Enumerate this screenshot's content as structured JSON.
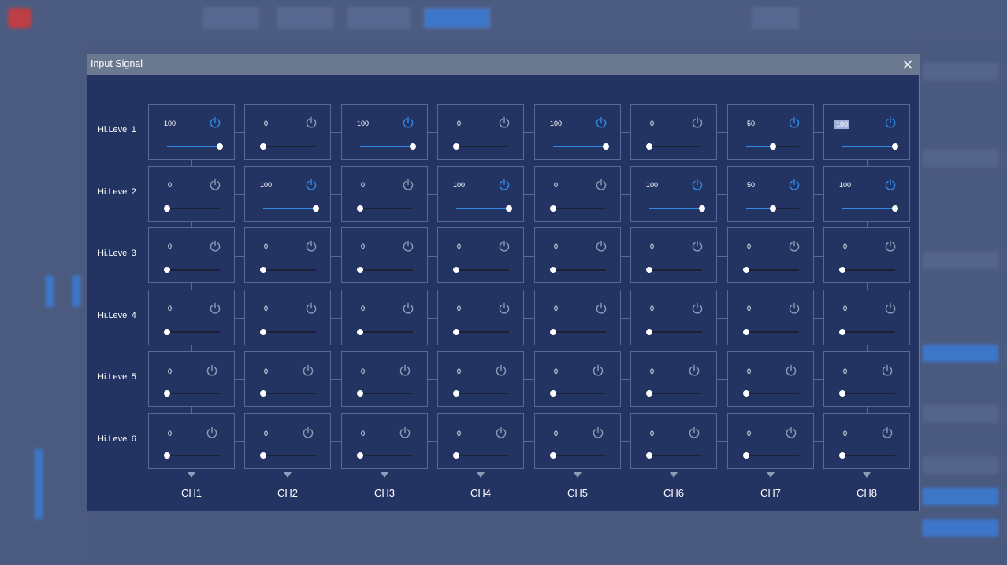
{
  "dialog": {
    "title": "Input Signal"
  },
  "colors": {
    "dialog_bg": "#243462",
    "power_on": "#2f8ae6",
    "power_off": "#8e9bb8",
    "slider_fill": "#2f8ae6",
    "title_bar": "#6a7890"
  },
  "rows": [
    {
      "label": "Hi.Level 1"
    },
    {
      "label": "Hi.Level 2"
    },
    {
      "label": "Hi.Level 3"
    },
    {
      "label": "Hi.Level 4"
    },
    {
      "label": "Hi.Level 5"
    },
    {
      "label": "Hi.Level 6"
    }
  ],
  "channels": [
    {
      "label": "CH1"
    },
    {
      "label": "CH2"
    },
    {
      "label": "CH3"
    },
    {
      "label": "CH4"
    },
    {
      "label": "CH5"
    },
    {
      "label": "CH6"
    },
    {
      "label": "CH7"
    },
    {
      "label": "CH8"
    }
  ],
  "matrix": [
    [
      {
        "value": "100",
        "on": true
      },
      {
        "value": "0",
        "on": false
      },
      {
        "value": "100",
        "on": true
      },
      {
        "value": "0",
        "on": false
      },
      {
        "value": "100",
        "on": true
      },
      {
        "value": "0",
        "on": false
      },
      {
        "value": "50",
        "on": true
      },
      {
        "value": "100",
        "on": true,
        "selected": true
      }
    ],
    [
      {
        "value": "0",
        "on": false
      },
      {
        "value": "100",
        "on": true
      },
      {
        "value": "0",
        "on": false
      },
      {
        "value": "100",
        "on": true
      },
      {
        "value": "0",
        "on": false
      },
      {
        "value": "100",
        "on": true
      },
      {
        "value": "50",
        "on": true
      },
      {
        "value": "100",
        "on": true
      }
    ],
    [
      {
        "value": "0",
        "on": false
      },
      {
        "value": "0",
        "on": false
      },
      {
        "value": "0",
        "on": false
      },
      {
        "value": "0",
        "on": false
      },
      {
        "value": "0",
        "on": false
      },
      {
        "value": "0",
        "on": false
      },
      {
        "value": "0",
        "on": false
      },
      {
        "value": "0",
        "on": false
      }
    ],
    [
      {
        "value": "0",
        "on": false
      },
      {
        "value": "0",
        "on": false
      },
      {
        "value": "0",
        "on": false
      },
      {
        "value": "0",
        "on": false
      },
      {
        "value": "0",
        "on": false
      },
      {
        "value": "0",
        "on": false
      },
      {
        "value": "0",
        "on": false
      },
      {
        "value": "0",
        "on": false
      }
    ],
    [
      {
        "value": "0",
        "on": false
      },
      {
        "value": "0",
        "on": false
      },
      {
        "value": "0",
        "on": false
      },
      {
        "value": "0",
        "on": false
      },
      {
        "value": "0",
        "on": false
      },
      {
        "value": "0",
        "on": false
      },
      {
        "value": "0",
        "on": false
      },
      {
        "value": "0",
        "on": false
      }
    ],
    [
      {
        "value": "0",
        "on": false
      },
      {
        "value": "0",
        "on": false
      },
      {
        "value": "0",
        "on": false
      },
      {
        "value": "0",
        "on": false
      },
      {
        "value": "0",
        "on": false
      },
      {
        "value": "0",
        "on": false
      },
      {
        "value": "0",
        "on": false
      },
      {
        "value": "0",
        "on": false
      }
    ]
  ]
}
